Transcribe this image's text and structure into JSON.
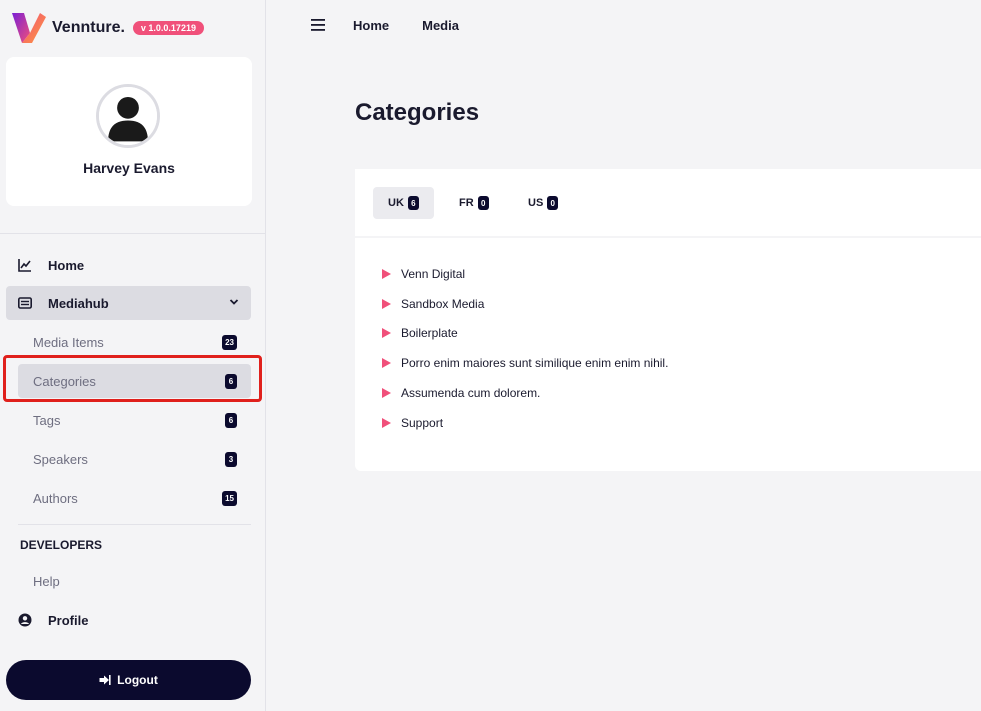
{
  "brand": {
    "name": "Vennture.",
    "version": "v 1.0.0.17219"
  },
  "profile": {
    "name": "Harvey Evans"
  },
  "nav": {
    "home": "Home",
    "mediahub": "Mediahub",
    "sub_items": [
      {
        "label": "Media Items",
        "count": "23"
      },
      {
        "label": "Categories",
        "count": "6"
      },
      {
        "label": "Tags",
        "count": "6"
      },
      {
        "label": "Speakers",
        "count": "3"
      },
      {
        "label": "Authors",
        "count": "15"
      }
    ],
    "developers_title": "DEVELOPERS",
    "help": "Help",
    "profile": "Profile",
    "logout": "Logout"
  },
  "breadcrumb": {
    "home": "Home",
    "media": "Media"
  },
  "page": {
    "title": "Categories"
  },
  "tabs": [
    {
      "label": "UK",
      "count": "6"
    },
    {
      "label": "FR",
      "count": "0"
    },
    {
      "label": "US",
      "count": "0"
    }
  ],
  "categories": [
    "Venn Digital",
    "Sandbox Media",
    "Boilerplate",
    "Porro enim maiores sunt similique enim enim nihil.",
    "Assumenda cum dolorem.",
    "Support"
  ],
  "colors": {
    "accent": "#f0507a",
    "dark": "#0b0a2e",
    "highlight": "#e0201c"
  }
}
